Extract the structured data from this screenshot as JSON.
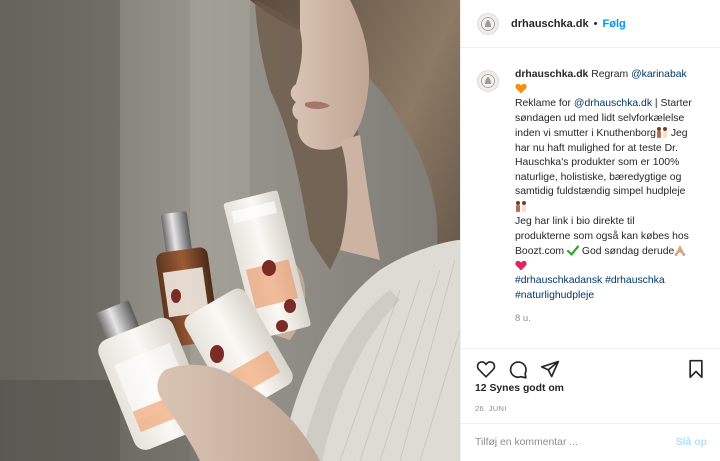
{
  "photo": {
    "icon": "post-photo"
  },
  "header": {
    "username": "drhauschka.dk",
    "separator": "•",
    "follow_label": "Følg"
  },
  "caption": {
    "username": "drhauschka.dk",
    "regram_label": "Regram",
    "regram_user": "@karinabak",
    "lines": [
      "Reklame for ",
      "@drhauschka.dk",
      " | Starter",
      "søndagen ud med lidt selvforkælelse",
      "inden vi smutter i Knuthenborg",
      " Jeg",
      "har nu haft mulighed for at teste Dr.",
      "Hauschka's produkter som er 100%",
      "naturlige, holistiske, bæredygtige og",
      "samtidig fuldstændig simpel hudpleje",
      "Jeg har link i bio direkte til",
      "produkterne som også kan købes hos",
      "Boozt.com",
      " God søndag derude",
      "#drhauschkadansk",
      " ",
      "#drhauschka",
      "#naturlighudpleje"
    ],
    "age": "8 u."
  },
  "actions": {
    "like_icon": "heart-icon",
    "comment_icon": "comment-icon",
    "share_icon": "share-icon",
    "save_icon": "bookmark-icon"
  },
  "likes": "12 Synes godt om",
  "date": "26. JUNI",
  "comment": {
    "placeholder": "Tilføj en kommentar ...",
    "post_label": "Slå op"
  },
  "colors": {
    "link": "#00376b",
    "follow": "#0095f6",
    "post_disabled": "#b2dffc",
    "muted": "#8e8e8e",
    "heart_orange": "#f4900c",
    "heart_pink": "#e0245e",
    "check_green": "#2fa82a"
  }
}
